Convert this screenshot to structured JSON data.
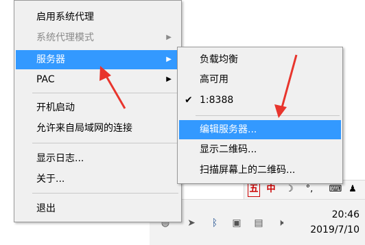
{
  "main_menu": {
    "items": [
      {
        "label": "启用系统代理"
      },
      {
        "label": "系统代理模式"
      },
      {
        "label": "服务器"
      },
      {
        "label": "PAC"
      },
      {
        "label": "开机启动"
      },
      {
        "label": "允许来自局域网的连接"
      },
      {
        "label": "显示日志..."
      },
      {
        "label": "关于..."
      },
      {
        "label": "退出"
      }
    ]
  },
  "server_submenu": {
    "items": [
      {
        "label": "负载均衡"
      },
      {
        "label": "高可用"
      },
      {
        "label": "1:8388",
        "checked": true
      },
      {
        "label": "编辑服务器..."
      },
      {
        "label": "显示二维码..."
      },
      {
        "label": "扫描屏幕上的二维码..."
      }
    ]
  },
  "ime_bar": {
    "items": [
      "五",
      "中"
    ]
  },
  "taskbar": {
    "time": "20:46",
    "date": "2019/7/10"
  },
  "colors": {
    "highlight": "#3399ff",
    "annotation_arrow": "#e8352d"
  }
}
